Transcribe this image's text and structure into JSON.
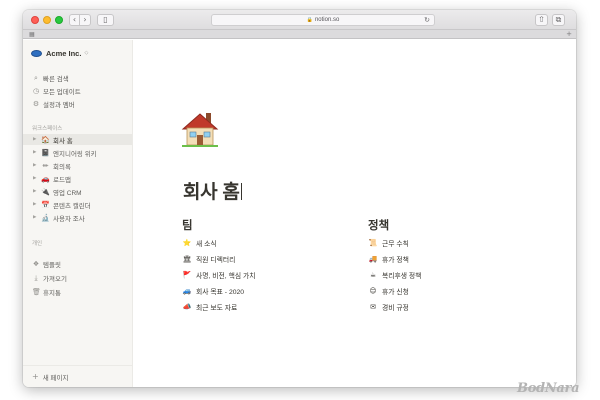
{
  "browser": {
    "url": "notion.so",
    "lock_icon": "🔒",
    "reload_icon": "↻",
    "back_icon": "‹",
    "forward_icon": "›",
    "sidebar_icon": "▯",
    "share_icon": "⇧",
    "tabs_icon": "⧉",
    "tabstrip_icon": "▦",
    "new_tab_icon": "+"
  },
  "sidebar": {
    "workspace_name": "Acme Inc.",
    "workspace_caret": "◇",
    "quick_items": [
      {
        "icon": "⌕",
        "label": "빠른 검색"
      },
      {
        "icon": "◷",
        "label": "모든 업데이트"
      },
      {
        "icon": "⚙",
        "label": "설정과 멤버"
      }
    ],
    "workspace_section_label": "워크스페이스",
    "pages": [
      {
        "emoji": "🏠",
        "label": "회사 홈",
        "active": true
      },
      {
        "emoji": "📓",
        "label": "엔지니어링 위키"
      },
      {
        "emoji": "✏",
        "label": "회의록"
      },
      {
        "emoji": "🚗",
        "label": "로드맵"
      },
      {
        "emoji": "🔌",
        "label": "영업 CRM"
      },
      {
        "emoji": "📅",
        "label": "콘텐츠 캘린더"
      },
      {
        "emoji": "🔬",
        "label": "사용자 조사"
      }
    ],
    "private_section_label": "개인",
    "bottom_items": [
      {
        "icon": "❖",
        "label": "템플릿"
      },
      {
        "icon": "⤓",
        "label": "가져오기"
      },
      {
        "icon": "🗑",
        "label": "휴지통"
      }
    ],
    "new_page_icon": "+",
    "new_page_label": "새 페이지"
  },
  "page": {
    "icon": "house-icon",
    "title": "회사 홈",
    "team": {
      "heading": "팀",
      "links": [
        {
          "emoji": "⭐",
          "label": "새 소식"
        },
        {
          "emoji": "🏛",
          "label": "직원 디렉터리"
        },
        {
          "emoji": "🚩",
          "label": "사명, 비전, 핵심 가치"
        },
        {
          "emoji": "🚙",
          "label": "회사 목표 - 2020"
        },
        {
          "emoji": "📣",
          "label": "최근 보도 자료"
        }
      ]
    },
    "policy": {
      "heading": "정책",
      "links": [
        {
          "emoji": "📜",
          "label": "근무 수칙"
        },
        {
          "emoji": "🚚",
          "label": "휴가 정책"
        },
        {
          "emoji": "☕",
          "label": "복리후생 정책"
        },
        {
          "emoji": "😌",
          "label": "휴가 신청"
        },
        {
          "emoji": "✉",
          "label": "경비 규정"
        }
      ]
    }
  },
  "watermark": {
    "text": "BodNara"
  },
  "colors": {
    "sidebar_bg": "#f7f6f3",
    "text_primary": "#37352f",
    "text_secondary": "#5f5e5b",
    "workspace_logo": "#2f6fc0"
  }
}
